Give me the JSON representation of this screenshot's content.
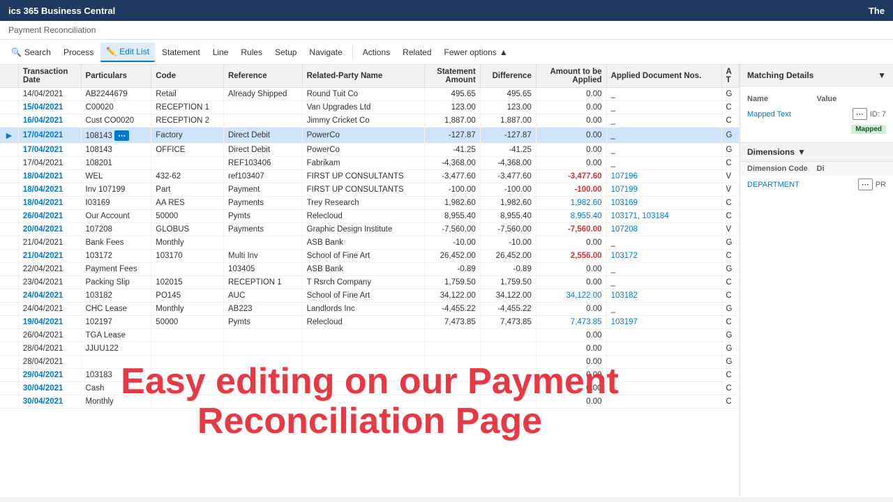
{
  "topBar": {
    "title": "ics 365 Business Central",
    "rightText": "The"
  },
  "breadcrumb": {
    "label": "Payment Reconciliation"
  },
  "toolbar": {
    "searchLabel": "Search",
    "processLabel": "Process",
    "editListLabel": "Edit List",
    "statementLabel": "Statement",
    "lineLabel": "Line",
    "rulesLabel": "Rules",
    "setupLabel": "Setup",
    "navigateLabel": "Navigate",
    "actionsLabel": "Actions",
    "relatedLabel": "Related",
    "fewerOptionsLabel": "Fewer options"
  },
  "tableColumns": [
    "Transaction Date",
    "Particulars",
    "Code",
    "Reference",
    "Related-Party Name",
    "Statement Amount",
    "Difference",
    "Amount to be Applied",
    "Applied Document Nos.",
    "A T"
  ],
  "tableRows": [
    {
      "date": "14/04/2021",
      "dateHighlight": false,
      "particulars": "AB2244679",
      "code": "Retail",
      "reference": "Already Shipped",
      "relatedParty": "Round Tuit Co",
      "statementAmt": "495.65",
      "difference": "495.65",
      "amtToApply": "0.00",
      "appliedDoc": "_",
      "at": "G",
      "amtColor": ""
    },
    {
      "date": "15/04/2021",
      "dateHighlight": true,
      "particulars": "C00020",
      "code": "RECEPTION 1",
      "reference": "",
      "relatedParty": "Van Upgrades Ltd",
      "statementAmt": "123.00",
      "difference": "123.00",
      "amtToApply": "0.00",
      "appliedDoc": "_",
      "at": "C",
      "amtColor": ""
    },
    {
      "date": "16/04/2021",
      "dateHighlight": true,
      "particulars": "Cust CO0020",
      "code": "RECEPTION 2",
      "reference": "",
      "relatedParty": "Jimmy Cricket Co",
      "statementAmt": "1,887.00",
      "difference": "1,887.00",
      "amtToApply": "0.00",
      "appliedDoc": "_",
      "at": "C",
      "amtColor": ""
    },
    {
      "date": "17/04/2021",
      "dateHighlight": true,
      "particulars": "108143",
      "code": "Factory",
      "reference": "Direct Debit",
      "relatedParty": "PowerCo",
      "statementAmt": "-127.87",
      "difference": "-127.87",
      "amtToApply": "0.00",
      "appliedDoc": "_",
      "at": "G",
      "amtColor": "",
      "selected": true,
      "hasEllipsis": true
    },
    {
      "date": "17/04/2021",
      "dateHighlight": true,
      "particulars": "108143",
      "code": "OFFICE",
      "reference": "Direct Debit",
      "relatedParty": "PowerCo",
      "statementAmt": "-41.25",
      "difference": "-41.25",
      "amtToApply": "0.00",
      "appliedDoc": "_",
      "at": "G",
      "amtColor": ""
    },
    {
      "date": "17/04/2021",
      "dateHighlight": false,
      "particulars": "108201",
      "code": "",
      "reference": "REF103406",
      "relatedParty": "Fabrikam",
      "statementAmt": "-4,368.00",
      "difference": "-4,368.00",
      "amtToApply": "0.00",
      "appliedDoc": "_",
      "at": "C",
      "amtColor": ""
    },
    {
      "date": "18/04/2021",
      "dateHighlight": true,
      "particulars": "WEL",
      "code": "432-62",
      "reference": "ref103407",
      "relatedParty": "FIRST UP CONSULTANTS",
      "statementAmt": "-3,477.60",
      "difference": "-3,477.60",
      "amtToApply": "-3,477.60",
      "appliedDoc": "107196",
      "at": "V",
      "amtColor": "red"
    },
    {
      "date": "18/04/2021",
      "dateHighlight": true,
      "particulars": "Inv 107199",
      "code": "Part",
      "reference": "Payment",
      "relatedParty": "FIRST UP CONSULTANTS",
      "statementAmt": "-100.00",
      "difference": "-100.00",
      "amtToApply": "-100.00",
      "appliedDoc": "107199",
      "at": "V",
      "amtColor": "red"
    },
    {
      "date": "18/04/2021",
      "dateHighlight": true,
      "particulars": "I03169",
      "code": "AA RES",
      "reference": "Payments",
      "relatedParty": "Trey Research",
      "statementAmt": "1,982.60",
      "difference": "1,982.60",
      "amtToApply": "1,982.60",
      "appliedDoc": "103169",
      "at": "C",
      "amtColor": "blue"
    },
    {
      "date": "26/04/2021",
      "dateHighlight": true,
      "particulars": "Our Account",
      "code": "50000",
      "reference": "Pymts",
      "relatedParty": "Relecloud",
      "statementAmt": "8,955.40",
      "difference": "8,955.40",
      "amtToApply": "8,955.40",
      "appliedDoc": "103171, 103184",
      "at": "C",
      "amtColor": "blue"
    },
    {
      "date": "20/04/2021",
      "dateHighlight": true,
      "particulars": "107208",
      "code": "GLOBUS",
      "reference": "Payments",
      "relatedParty": "Graphic Design Institute",
      "statementAmt": "-7,560.00",
      "difference": "-7,560.00",
      "amtToApply": "-7,560.00",
      "appliedDoc": "107208",
      "at": "V",
      "amtColor": "red"
    },
    {
      "date": "21/04/2021",
      "dateHighlight": false,
      "particulars": "Bank Fees",
      "code": "Monthly",
      "reference": "",
      "relatedParty": "ASB Bank",
      "statementAmt": "-10.00",
      "difference": "-10.00",
      "amtToApply": "0.00",
      "appliedDoc": "_",
      "at": "G",
      "amtColor": ""
    },
    {
      "date": "21/04/2021",
      "dateHighlight": true,
      "particulars": "103172",
      "code": "103170",
      "reference": "Multi Inv",
      "relatedParty": "School of Fine Art",
      "statementAmt": "26,452.00",
      "difference": "26,452.00",
      "amtToApply": "2,556.00",
      "appliedDoc": "103172",
      "at": "C",
      "amtColor": "red"
    },
    {
      "date": "22/04/2021",
      "dateHighlight": false,
      "particulars": "Payment Fees",
      "code": "",
      "reference": "103405",
      "relatedParty": "ASB Bank",
      "statementAmt": "-0.89",
      "difference": "-0.89",
      "amtToApply": "0.00",
      "appliedDoc": "_",
      "at": "G",
      "amtColor": ""
    },
    {
      "date": "23/04/2021",
      "dateHighlight": false,
      "particulars": "Packing Slip",
      "code": "102015",
      "reference": "RECEPTION 1",
      "relatedParty": "T Rsrch Company",
      "statementAmt": "1,759.50",
      "difference": "1,759.50",
      "amtToApply": "0.00",
      "appliedDoc": "_",
      "at": "C",
      "amtColor": ""
    },
    {
      "date": "24/04/2021",
      "dateHighlight": true,
      "particulars": "103182",
      "code": "PO145",
      "reference": "AUC",
      "relatedParty": "School of Fine Art",
      "statementAmt": "34,122.00",
      "difference": "34,122.00",
      "amtToApply": "34,122.00",
      "appliedDoc": "103182",
      "at": "C",
      "amtColor": "blue"
    },
    {
      "date": "24/04/2021",
      "dateHighlight": false,
      "particulars": "CHC Lease",
      "code": "Monthly",
      "reference": "AB223",
      "relatedParty": "Landlords Inc",
      "statementAmt": "-4,455.22",
      "difference": "-4,455.22",
      "amtToApply": "0.00",
      "appliedDoc": "_",
      "at": "G",
      "amtColor": ""
    },
    {
      "date": "19/04/2021",
      "dateHighlight": true,
      "particulars": "102197",
      "code": "50000",
      "reference": "Pymts",
      "relatedParty": "Relecloud",
      "statementAmt": "7,473.85",
      "difference": "7,473.85",
      "amtToApply": "7,473.85",
      "appliedDoc": "103197",
      "at": "C",
      "amtColor": "blue"
    },
    {
      "date": "26/04/2021",
      "dateHighlight": false,
      "particulars": "TGA Lease",
      "code": "",
      "reference": "",
      "relatedParty": "",
      "statementAmt": "",
      "difference": "",
      "amtToApply": "0.00",
      "appliedDoc": "",
      "at": "G",
      "amtColor": ""
    },
    {
      "date": "28/04/2021",
      "dateHighlight": false,
      "particulars": "JJUU122",
      "code": "",
      "reference": "",
      "relatedParty": "",
      "statementAmt": "",
      "difference": "",
      "amtToApply": "0.00",
      "appliedDoc": "",
      "at": "G",
      "amtColor": ""
    },
    {
      "date": "28/04/2021",
      "dateHighlight": false,
      "particulars": "",
      "code": "",
      "reference": "",
      "relatedParty": "",
      "statementAmt": "",
      "difference": "",
      "amtToApply": "0.00",
      "appliedDoc": "",
      "at": "G",
      "amtColor": ""
    },
    {
      "date": "29/04/2021",
      "dateHighlight": true,
      "particulars": "103183",
      "code": "",
      "reference": "",
      "relatedParty": "",
      "statementAmt": "",
      "difference": "",
      "amtToApply": "0.00",
      "appliedDoc": "",
      "at": "C",
      "amtColor": ""
    },
    {
      "date": "30/04/2021",
      "dateHighlight": true,
      "particulars": "Cash",
      "code": "",
      "reference": "",
      "relatedParty": "",
      "statementAmt": "",
      "difference": "",
      "amtToApply": "0.00",
      "appliedDoc": "",
      "at": "C",
      "amtColor": ""
    },
    {
      "date": "30/04/2021",
      "dateHighlight": true,
      "particulars": "Monthly",
      "code": "",
      "reference": "",
      "relatedParty": "",
      "statementAmt": "",
      "difference": "",
      "amtToApply": "0.00",
      "appliedDoc": "",
      "at": "C",
      "amtColor": ""
    }
  ],
  "matchingDetails": {
    "title": "Matching Details",
    "nameHeader": "Name",
    "valueHeader": "Value",
    "mappedTextLabel": "Mapped Text",
    "mappedTextValue": "ID: 7",
    "mappedBadge": "Mapped"
  },
  "dimensions": {
    "title": "Dimensions",
    "codeHeader": "Dimension Code",
    "valueHeader": "Di",
    "departmentCode": "DEPARTMENT",
    "departmentValue": "PR"
  },
  "overlayText": {
    "line1": "Easy editing on our Payment",
    "line2": "Reconciliation Page"
  }
}
